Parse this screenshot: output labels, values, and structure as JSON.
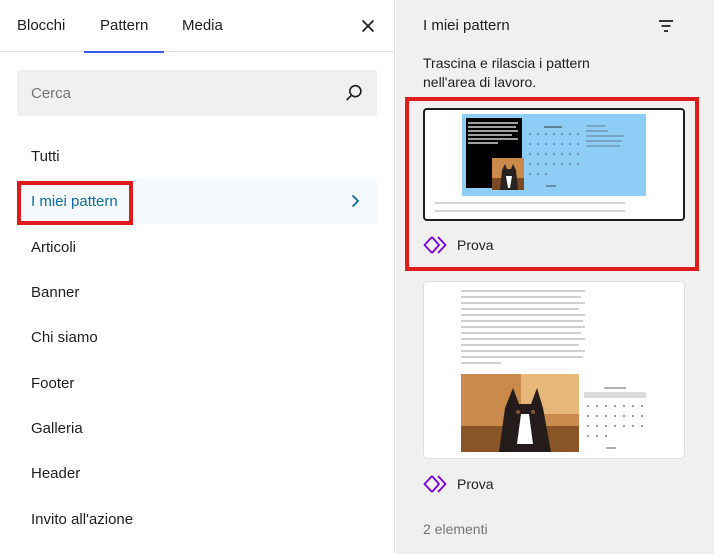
{
  "inserter": {
    "tabs": [
      {
        "label": "Blocchi"
      },
      {
        "label": "Pattern"
      },
      {
        "label": "Media"
      }
    ],
    "close_icon": "close-icon",
    "search": {
      "placeholder": "Cerca",
      "value": "",
      "icon": "search-icon"
    },
    "categories": [
      {
        "label": "Tutti"
      },
      {
        "label": "I miei pattern",
        "selected": true
      },
      {
        "label": "Articoli"
      },
      {
        "label": "Banner"
      },
      {
        "label": "Chi siamo"
      },
      {
        "label": "Footer"
      },
      {
        "label": "Galleria"
      },
      {
        "label": "Header"
      },
      {
        "label": "Invito all'azione"
      }
    ]
  },
  "pattern_panel": {
    "title": "I miei pattern",
    "filter_icon": "filter-icon",
    "hint": "Trascina e rilascia i pattern nell'area di lavoro.",
    "patterns": [
      {
        "name": "Prova",
        "icon": "synced-pattern-icon"
      },
      {
        "name": "Prova",
        "icon": "synced-pattern-icon"
      }
    ],
    "count": "2 elementi"
  },
  "colors": {
    "accent": "#3858e9",
    "selected_text": "#0b6da0",
    "highlight": "#e01b1b",
    "pattern_icon": "#7a00df"
  }
}
